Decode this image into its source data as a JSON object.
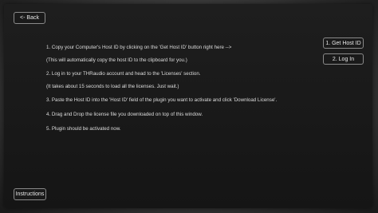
{
  "buttons": {
    "back": "<- Back",
    "get_host_id": "1. Get Host ID",
    "log_in": "2. Log In",
    "instructions": "Instructions"
  },
  "steps": [
    "1. Copy your Computer's Host ID by clicking on the 'Get Host ID' button right here -->",
    "(This will automatically copy the host ID to the clipboard for you.)",
    "2. Log in to your THRaudio account and head to the 'Licenses' section.",
    "(It takes about 15 seconds to load all the licenses. Just wait.)",
    "3. Paste the Host ID into the 'Host ID' field of the plugin you want to activate and click 'Download License'.",
    "4. Drag and Drop the license file you downloaded on top of this window.",
    "5. Plugin should be activated now."
  ]
}
